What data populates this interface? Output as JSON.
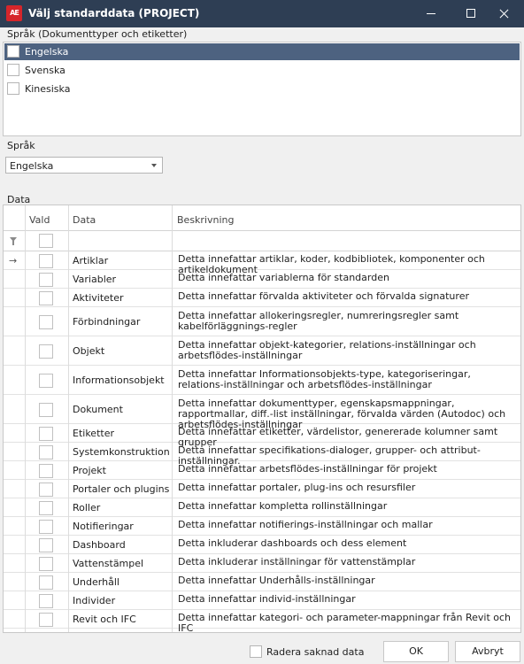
{
  "window": {
    "title": "Välj standarddata (PROJECT)",
    "logo_text": "AE"
  },
  "languages": {
    "label": "Språk (Dokumenttyper och etiketter)",
    "items": [
      {
        "label": "Engelska",
        "selected": true
      },
      {
        "label": "Svenska",
        "selected": false
      },
      {
        "label": "Kinesiska",
        "selected": false
      }
    ]
  },
  "language_select": {
    "label": "Språk",
    "value": "Engelska"
  },
  "data_grid": {
    "label": "Data",
    "columns": {
      "vald": "Vald",
      "data": "Data",
      "beskrivning": "Beskrivning"
    },
    "current_row_marker": "→",
    "rows": [
      {
        "name": "Artiklar",
        "desc": "Detta innefattar artiklar, koder, kodbibliotek, komponenter och artikeldokument"
      },
      {
        "name": "Variabler",
        "desc": "Detta innefattar variablerna för standarden"
      },
      {
        "name": "Aktiviteter",
        "desc": "Detta innefattar förvalda aktiviteter och förvalda signaturer"
      },
      {
        "name": "Förbindningar",
        "desc": "Detta innefattar allokeringsregler, numreringsregler samt kabelförläggnings-regler"
      },
      {
        "name": "Objekt",
        "desc": "Detta innefattar objekt-kategorier, relations-inställningar och arbetsflödes-inställningar"
      },
      {
        "name": "Informationsobjekt",
        "desc": "Detta innefattar Informationsobjekts-type, kategoriseringar, relations-inställningar och arbetsflödes-inställningar"
      },
      {
        "name": "Dokument",
        "desc": "Detta innefattar dokumenttyper, egenskapsmappningar, rapportmallar, diff.-list inställningar, förvalda värden (Autodoc) och arbetsflödes-inställningar"
      },
      {
        "name": "Etiketter",
        "desc": "Detta innefattar etiketter, värdelistor, genererade kolumner samt grupper"
      },
      {
        "name": "Systemkonstruktion",
        "desc": "Detta innefattar specifikations-dialoger, grupper- och attribut-inställningar."
      },
      {
        "name": "Projekt",
        "desc": "Detta innefattar arbetsflödes-inställningar för projekt"
      },
      {
        "name": "Portaler och plugins",
        "desc": "Detta innefattar portaler, plug-ins och resursfiler"
      },
      {
        "name": "Roller",
        "desc": "Detta innefattar kompletta rollinställningar"
      },
      {
        "name": "Notifieringar",
        "desc": "Detta innefattar notifierings-inställningar och mallar"
      },
      {
        "name": "Dashboard",
        "desc": "Detta inkluderar dashboards och dess element"
      },
      {
        "name": "Vattenstämpel",
        "desc": "Detta inkluderar inställningar för vattenstämplar"
      },
      {
        "name": "Underhåll",
        "desc": "Detta innefattar Underhålls-inställningar"
      },
      {
        "name": "Individer",
        "desc": "Detta innefattar individ-inställningar"
      },
      {
        "name": "Revit och IFC",
        "desc": "Detta innefattar kategori- och parameter-mappningar från Revit och IFC"
      }
    ]
  },
  "footer": {
    "remove_missing_label": "Radera saknad data",
    "ok_label": "OK",
    "cancel_label": "Avbryt"
  }
}
